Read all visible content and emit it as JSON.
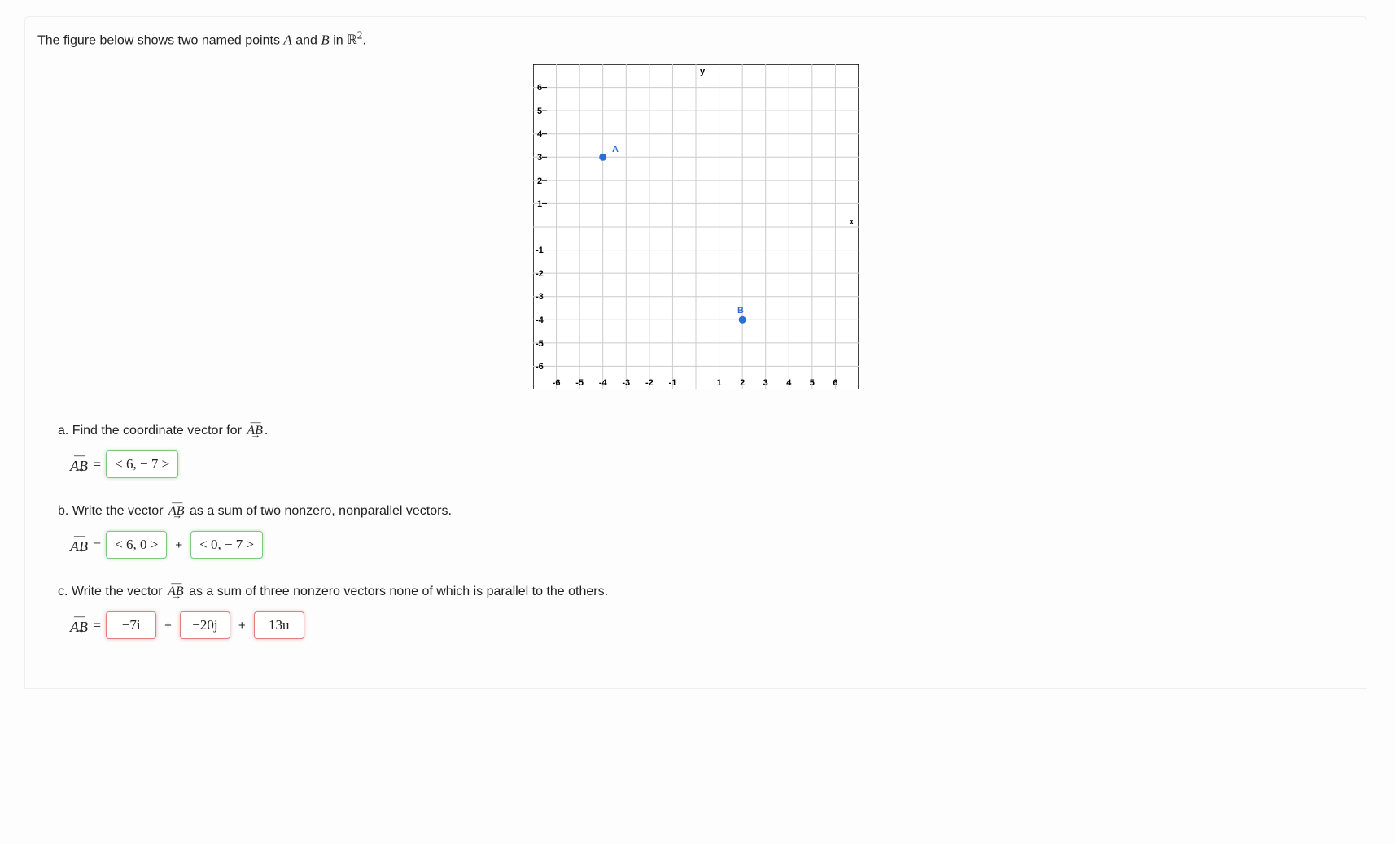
{
  "intro_prefix": "The figure below shows two named points ",
  "var_A": "A",
  "intro_and": " and ",
  "var_B": "B",
  "intro_suffix_1": " in ",
  "space_symbol": "ℝ",
  "space_exp": "2",
  "intro_period": ".",
  "chart_data": {
    "type": "scatter",
    "title": "",
    "xlabel": "x",
    "ylabel": "y",
    "xlim": [
      -7,
      7
    ],
    "ylim": [
      -7,
      7
    ],
    "xticks": [
      -6,
      -5,
      -4,
      -3,
      -2,
      -1,
      1,
      2,
      3,
      4,
      5,
      6
    ],
    "yticks": [
      -6,
      -5,
      -4,
      -3,
      -2,
      -1,
      1,
      2,
      3,
      4,
      5,
      6
    ],
    "points": [
      {
        "name": "A",
        "x": -4,
        "y": 3
      },
      {
        "name": "B",
        "x": 2,
        "y": -4
      }
    ]
  },
  "parts": {
    "a": {
      "prompt_prefix": "a. Find the coordinate vector for ",
      "vec_label": "AB",
      "prompt_suffix": ".",
      "eq_lhs": "AB",
      "eq_eq": " = ",
      "answer": "< 6,  − 7 >",
      "status": "correct"
    },
    "b": {
      "prompt_prefix": "b. Write the vector ",
      "vec_label": "AB",
      "prompt_suffix": " as a sum of two nonzero, nonparallel vectors.",
      "eq_lhs": "AB",
      "eq_eq": " = ",
      "answer1": "< 6, 0 >",
      "plus": "+",
      "answer2": "< 0,  − 7 >",
      "status": "correct"
    },
    "c": {
      "prompt_prefix": "c. Write the vector ",
      "vec_label": "AB",
      "prompt_suffix": " as a sum of three nonzero vectors none of which is parallel to the others.",
      "eq_lhs": "AB",
      "eq_eq": " = ",
      "answer1": "−7i",
      "plus1": "+",
      "answer2": "−20j",
      "plus2": "+",
      "answer3": "13u",
      "status": "incorrect"
    }
  }
}
